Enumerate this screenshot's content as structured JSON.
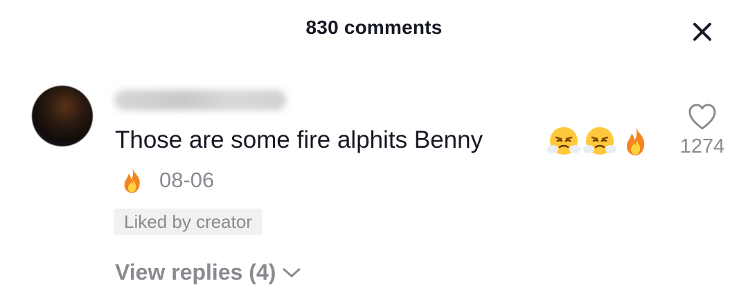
{
  "header": {
    "title": "830 comments",
    "close_icon": "close-icon"
  },
  "comment": {
    "username": "user_redacted",
    "text": "Those are some fire alphits Benny",
    "emojis": [
      "steam-face-emoji",
      "steam-face-emoji",
      "fire-emoji",
      "fire-emoji"
    ],
    "date": "08-06",
    "badge": "Liked by creator",
    "like_count": "1274",
    "view_replies": "View replies (4)"
  },
  "colors": {
    "text": "#161823",
    "muted": "#8a8b91",
    "badge_bg": "#f1f1f2"
  }
}
